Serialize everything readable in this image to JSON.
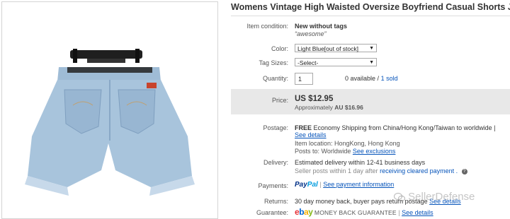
{
  "listing": {
    "title": "Womens Vintage High Waisted Oversize Boyfriend Casual Shorts Jean Pa"
  },
  "item_condition": {
    "label": "Item condition:",
    "value": "New without tags",
    "quote": "awesome"
  },
  "color": {
    "label": "Color:",
    "selected": "Light Blue[out of stock]"
  },
  "tag_sizes": {
    "label": "Tag Sizes:",
    "selected": "-Select-"
  },
  "quantity": {
    "label": "Quantity:",
    "value": "1",
    "available": "0 available /",
    "sold": "1 sold"
  },
  "price": {
    "label": "Price:",
    "amount": "US $12.95",
    "approx_prefix": "Approximately",
    "approx_amount": "AU $16.96"
  },
  "postage": {
    "label": "Postage:",
    "free": "FREE",
    "service": "Economy Shipping from China/Hong Kong/Taiwan to worldwide |",
    "see_details": "See details",
    "item_location": "Item location:  HongKong, Hong Kong",
    "posts_to": "Posts to:  Worldwide",
    "see_exclusions": "See exclusions"
  },
  "delivery": {
    "label": "Delivery:",
    "estimated": "Estimated delivery within 12-41 business days",
    "seller_posts": "Seller posts within 1 day after",
    "cleared": "receiving cleared payment ."
  },
  "payments": {
    "label": "Payments:",
    "paypal_a": "Pay",
    "paypal_b": "Pal",
    "sep": "|",
    "see_payment": "See payment information"
  },
  "returns": {
    "label": "Returns:",
    "text": "30 day money back, buyer pays return postage",
    "see_details": "See details"
  },
  "guarantee": {
    "label": "Guarantee:",
    "ebay_e": "e",
    "ebay_b": "b",
    "ebay_a": "a",
    "ebay_y": "y",
    "mbg": "MONEY BACK GUARANTEE",
    "sep": "|",
    "see_details": "See details"
  },
  "watermark": {
    "text": "SellerDefense"
  },
  "colors": {
    "link": "#0654ba",
    "price_band": "#e8e8e8",
    "denim": "#a8c4dc",
    "ebay_e": "#e53238",
    "ebay_b": "#0064d2",
    "ebay_a": "#f5af02",
    "ebay_y": "#86b817"
  },
  "icons": [
    "help-icon",
    "dropdown-arrow-icon",
    "wechat-icon",
    "hanger-icon"
  ]
}
